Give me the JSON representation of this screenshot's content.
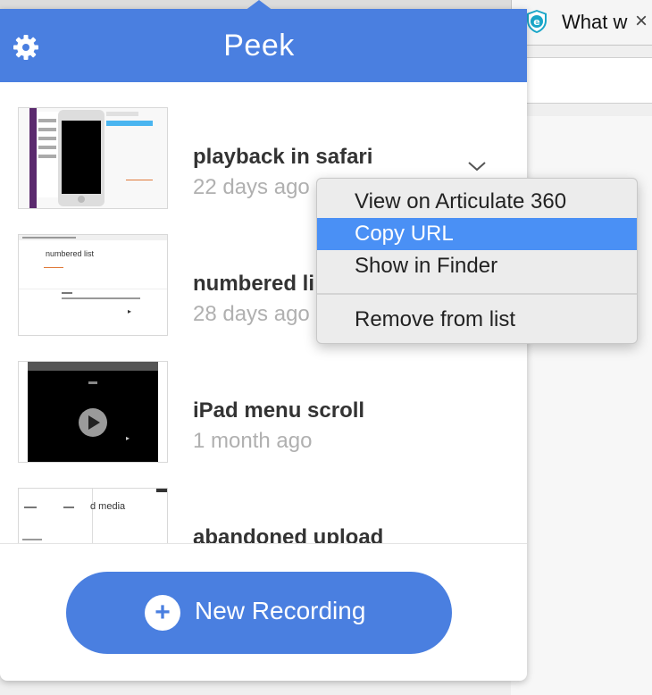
{
  "browser": {
    "tab_title": "What w",
    "close_glyph": "×"
  },
  "app": {
    "title": "Peek"
  },
  "recordings": [
    {
      "name": "playback in safari",
      "date": "22 days ago"
    },
    {
      "name": "numbered li",
      "date": "28 days ago"
    },
    {
      "name": "iPad menu scroll",
      "date": "1 month ago"
    },
    {
      "name": "abandoned upload",
      "date": ""
    }
  ],
  "thumb_text": {
    "t2_heading": "numbered list",
    "t4_heading": "d media"
  },
  "context_menu": {
    "items": [
      {
        "label": "View on Articulate 360"
      },
      {
        "label": "Copy URL"
      },
      {
        "label": "Show in Finder"
      },
      {
        "label": "Remove from list"
      }
    ]
  },
  "new_recording": {
    "label": "New Recording",
    "plus_glyph": "+"
  },
  "colors": {
    "accent": "#4a7fe0",
    "menu_highlight": "#4a90f5"
  }
}
